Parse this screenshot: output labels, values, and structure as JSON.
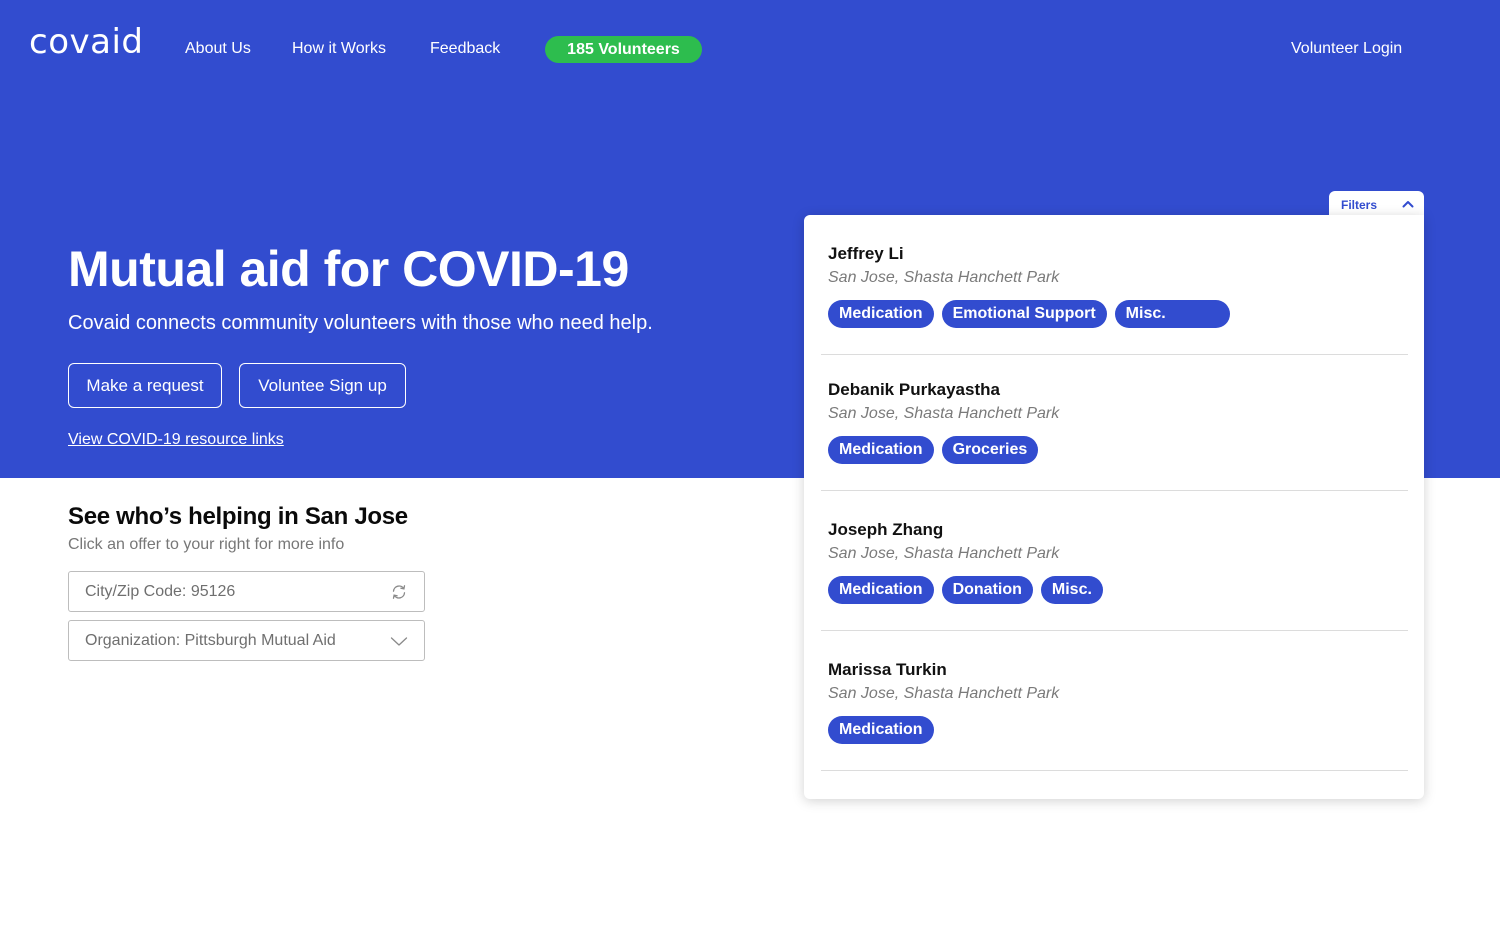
{
  "brand": {
    "logo": "covaid"
  },
  "nav": {
    "about": "About Us",
    "how": "How it Works",
    "feedback": "Feedback",
    "volunteers_badge": "185 Volunteers",
    "login": "Volunteer Login"
  },
  "hero": {
    "title": "Mutual aid for COVID-19",
    "subtitle": "Covaid connects community volunteers with those who need help.",
    "request_button": "Make a request",
    "volunteer_button": "Voluntee Sign up",
    "resource_link": "View COVID-19 resource links"
  },
  "section": {
    "title": "See who’s helping in San Jose",
    "subtitle": "Click an offer to your right for more info"
  },
  "filters_form": {
    "city_placeholder": "City/Zip Code: 95126",
    "org_value": "Organization: Pittsburgh Mutual Aid"
  },
  "filters_tab": {
    "label": "Filters"
  },
  "offers": [
    {
      "name": "Jeffrey Li",
      "location": "San Jose, Shasta Hanchett Park",
      "tags": [
        "Medication",
        "Emotional Support",
        "Misc."
      ]
    },
    {
      "name": "Debanik Purkayastha",
      "location": "San Jose, Shasta Hanchett Park",
      "tags": [
        "Medication",
        "Groceries"
      ]
    },
    {
      "name": "Joseph Zhang",
      "location": "San Jose, Shasta Hanchett Park",
      "tags": [
        "Medication",
        "Donation",
        "Misc."
      ]
    },
    {
      "name": "Marissa Turkin",
      "location": "San Jose, Shasta Hanchett Park",
      "tags": [
        "Medication"
      ]
    }
  ],
  "colors": {
    "primary": "#324ccf",
    "badge_green": "#2dbd4e"
  },
  "icons": {
    "refresh": "refresh-icon",
    "dropdown": "chevron-down-icon",
    "filters_toggle": "chevron-up-icon"
  }
}
